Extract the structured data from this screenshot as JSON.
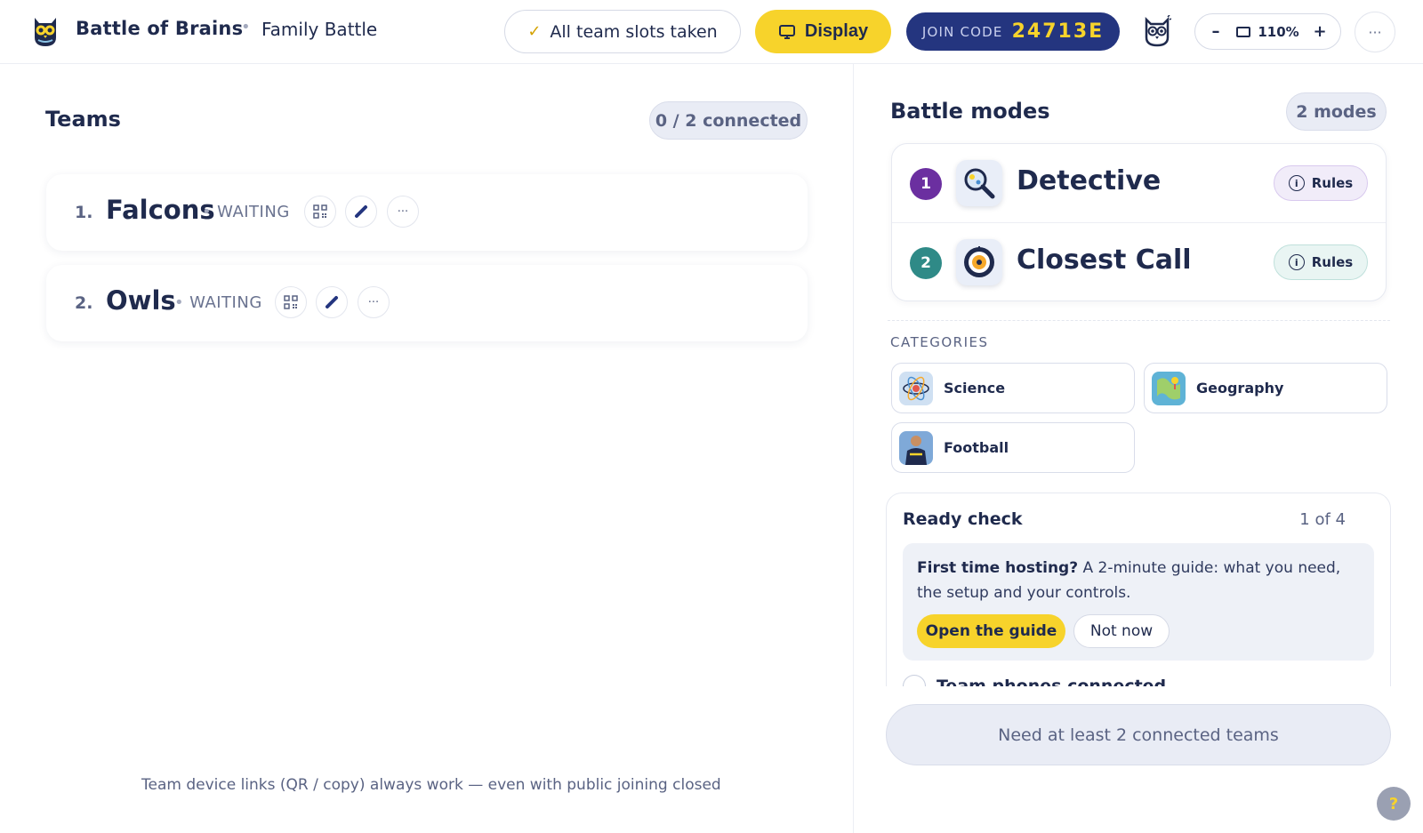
{
  "header": {
    "app_title": "Battle of Brains",
    "separator": "•",
    "game_name": "Family Battle",
    "slots_status": "All team slots taken",
    "slots_check": "✓",
    "display_label": "Display",
    "join_label": "JOIN CODE",
    "join_code": "24713E",
    "zoom_out": "–",
    "zoom_in": "+",
    "zoom_level": "110%",
    "more": "···"
  },
  "teams": {
    "title": "Teams",
    "connected": "0 / 2 connected",
    "items": [
      {
        "num": "1.",
        "name": "Falcons",
        "status": "WAITING"
      },
      {
        "num": "2.",
        "name": "Owls",
        "status": "WAITING"
      }
    ],
    "more": "···",
    "footer_note": "Team device links (QR / copy) always work — even with public joining closed"
  },
  "modes": {
    "title": "Battle modes",
    "count": "2 modes",
    "items": [
      {
        "index": "1",
        "name": "Detective",
        "rules": "Rules",
        "color": "#6b2fa0",
        "rules_bg": "#f1ecf9",
        "rules_border": "#d8c9ee"
      },
      {
        "index": "2",
        "name": "Closest Call",
        "rules": "Rules",
        "color": "#2f8a87",
        "rules_bg": "#e9f5f3",
        "rules_border": "#bfe0db"
      }
    ]
  },
  "categories": {
    "label": "CATEGORIES",
    "items": [
      {
        "name": "Science"
      },
      {
        "name": "Geography"
      },
      {
        "name": "Football"
      }
    ]
  },
  "ready": {
    "title": "Ready check",
    "count": "1 of 4",
    "guide_bold": "First time hosting?",
    "guide_text": " A 2-minute guide: what you need, the setup and your controls.",
    "open_guide": "Open the guide",
    "not_now": "Not now",
    "check_item": "Team phones connected"
  },
  "start_button": "Need at least 2 connected teams",
  "help": "?"
}
